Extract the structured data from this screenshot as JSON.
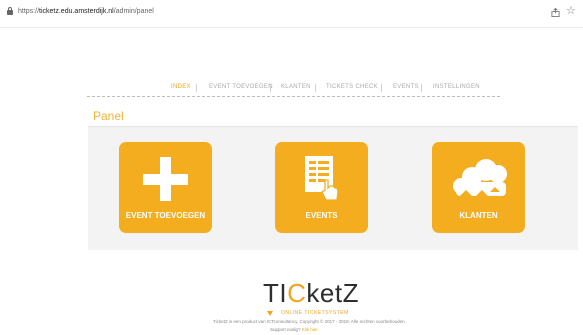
{
  "browser": {
    "url_prefix": "https://",
    "url_host": "ticketz.edu.amsterdijk.nl",
    "url_path": "/admin/panel"
  },
  "nav": {
    "items": [
      {
        "label": "INDEX",
        "active": true
      },
      {
        "label": "EVENT TOEVOEGEN",
        "active": false
      },
      {
        "label": "KLANTEN",
        "active": false
      },
      {
        "label": "TICKETS CHECK",
        "active": false
      },
      {
        "label": "EVENTS",
        "active": false
      },
      {
        "label": "INSTELLINGEN",
        "active": false
      }
    ]
  },
  "panel": {
    "title": "Panel",
    "tiles": [
      {
        "label": "EVENT TOEVOEGEN",
        "icon": "plus-icon"
      },
      {
        "label": "EVENTS",
        "icon": "document-hand-icon"
      },
      {
        "label": "KLANTEN",
        "icon": "clouds-icon"
      }
    ]
  },
  "footer": {
    "logo_pre": "TI",
    "logo_c": "C",
    "logo_post": "ketZ",
    "tagline": "ONLINE TICKETSYSTEM",
    "copyright": "TicketZ is een product van ICTconsultancy. Copyright © 2017 - 2018. Alle rechten voorbehouden.",
    "support_label": "Support nodig?",
    "support_link": "Klik hier"
  },
  "colors": {
    "accent": "#f1a51f",
    "tile": "#f3ad1e",
    "panel_bg": "#f3f3f3"
  }
}
